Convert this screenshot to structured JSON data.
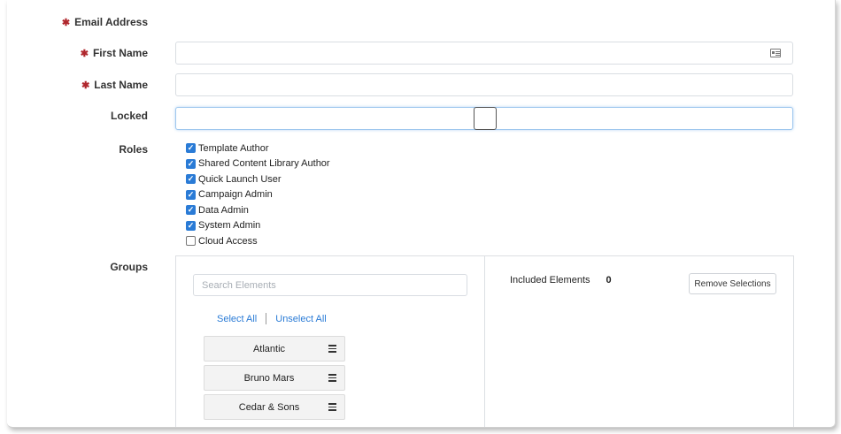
{
  "form": {
    "email": {
      "label": "Email Address",
      "required_mark": "✱"
    },
    "first_name": {
      "label": "First Name",
      "required_mark": "✱",
      "value": ""
    },
    "last_name": {
      "label": "Last Name",
      "required_mark": "✱",
      "value": ""
    },
    "locked": {
      "label": "Locked",
      "checked": false
    },
    "roles": {
      "label": "Roles",
      "items": [
        {
          "label": "Template Author",
          "checked": true
        },
        {
          "label": "Shared Content Library Author",
          "checked": true
        },
        {
          "label": "Quick Launch User",
          "checked": true
        },
        {
          "label": "Campaign Admin",
          "checked": true
        },
        {
          "label": "Data Admin",
          "checked": true
        },
        {
          "label": "System Admin",
          "checked": true
        },
        {
          "label": "Cloud Access",
          "checked": false
        }
      ]
    },
    "groups": {
      "label": "Groups",
      "search_placeholder": "Search Elements",
      "select_all": "Select All",
      "unselect_all": "Unselect All",
      "elements": [
        "Atlantic",
        "Bruno Mars",
        "Cedar & Sons"
      ],
      "included_label": "Included Elements",
      "included_count": "0",
      "remove_button": "Remove Selections"
    }
  },
  "colors": {
    "required": "#b0272d",
    "accent": "#2a7bd6",
    "focus": "#9ec7ee"
  },
  "icons": {
    "contact_card": "contact-card-icon",
    "checkbox_checked": "check-icon",
    "drag_handle": "hamburger-icon"
  }
}
